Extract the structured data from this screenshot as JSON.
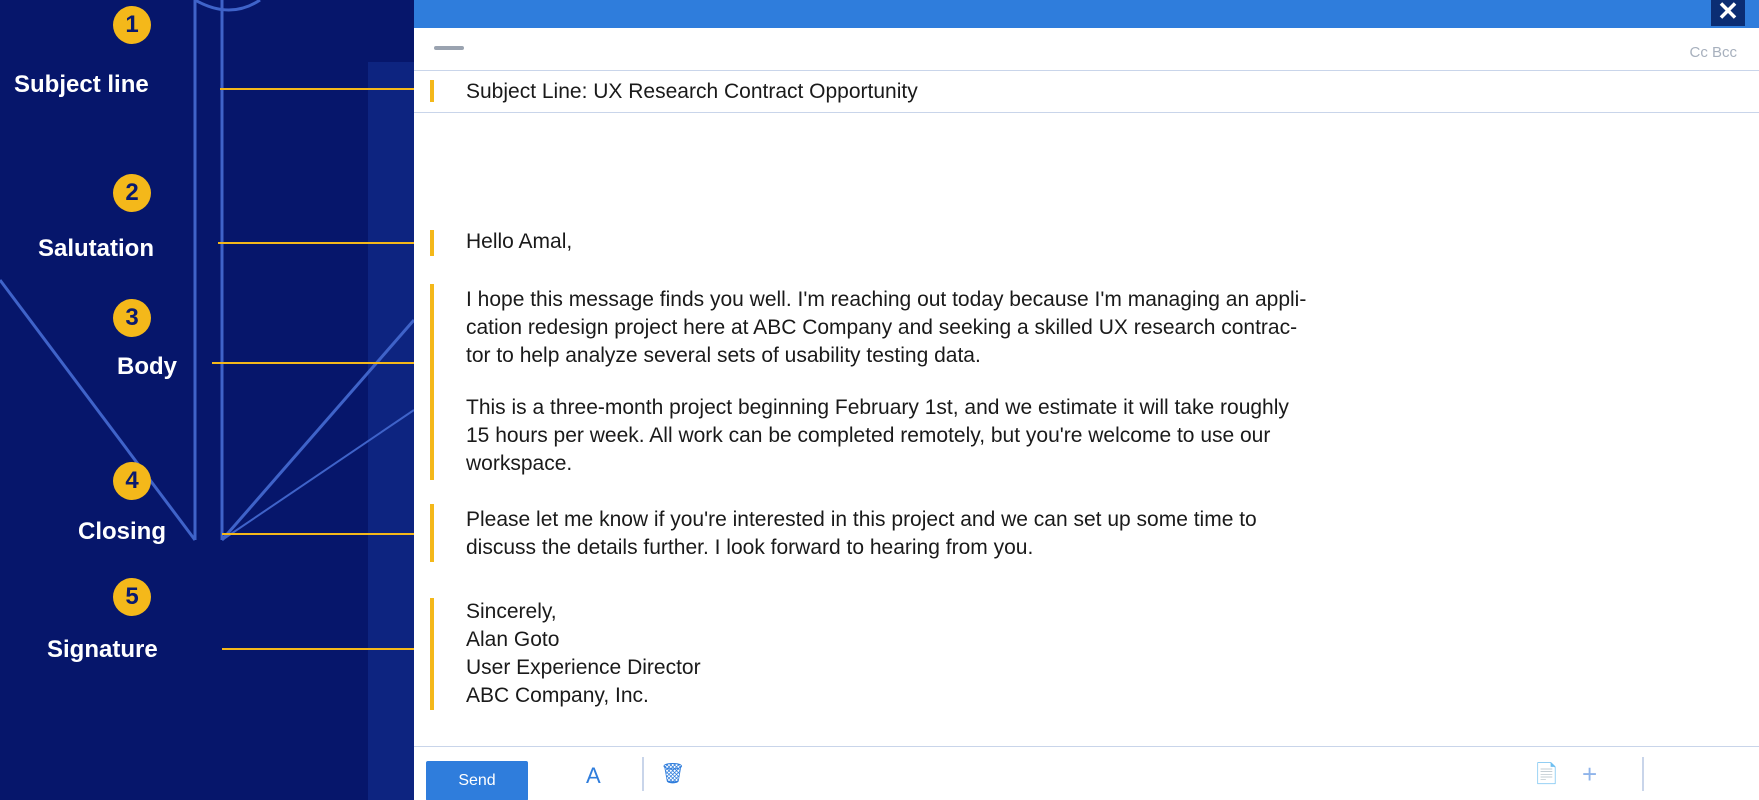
{
  "annotations": {
    "steps": [
      {
        "number": "1",
        "label": "Subject line"
      },
      {
        "number": "2",
        "label": "Salutation"
      },
      {
        "number": "3",
        "label": "Body"
      },
      {
        "number": "4",
        "label": "Closing"
      },
      {
        "number": "5",
        "label": "Signature"
      }
    ]
  },
  "email": {
    "title_bar": {
      "close_icon": "close-icon",
      "close_glyph": "✕"
    },
    "header": {
      "cc_bcc": "Cc Bcc"
    },
    "subject": "Subject Line: UX Research Contract Opportunity",
    "salutation": "Hello Amal,",
    "body": {
      "line1": "I hope this message finds you well. I'm reaching out today because I'm managing an appli-",
      "line2": "cation redesign project here at ABC Company and seeking a skilled UX research contrac-",
      "line3": "tor to help analyze several sets of usability testing data.",
      "line4": "This is a three-month project beginning February 1st, and we estimate it will take roughly",
      "line5": "15 hours per week. All work can be completed remotely, but you're welcome to use our",
      "line6": "workspace."
    },
    "closing": {
      "line1": "Please let me know if you're interested in this project and we can set up some time to",
      "line2": "discuss the details further. I look forward to hearing from you."
    },
    "signature": {
      "line1": "Sincerely,",
      "line2": "Alan Goto",
      "line3": "User Experience Director",
      "line4": "ABC Company, Inc."
    },
    "toolbar": {
      "send_label": "Send",
      "format_icon": "text-format-icon",
      "delete_icon": "trash-icon",
      "attach_icon": "attachment-icon",
      "more_icon": "plus-icon",
      "format_glyph": "A",
      "delete_glyph": "🗑",
      "attach_glyph": "📄",
      "more_glyph": "+"
    }
  },
  "colors": {
    "background": "#06166b",
    "accent": "#f4b81a",
    "title_bar": "#2f7ddc",
    "send_button": "#2f7ddc"
  }
}
